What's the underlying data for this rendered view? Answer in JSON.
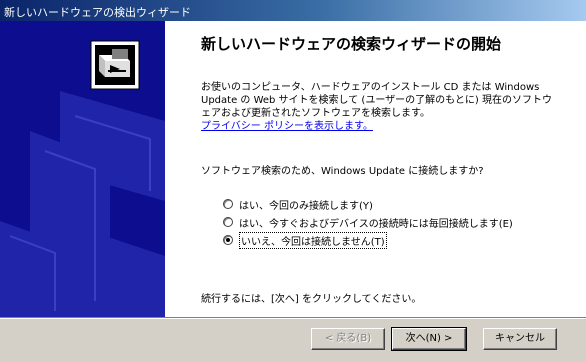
{
  "window": {
    "title": "新しいハードウェアの検出ウィザード"
  },
  "page": {
    "heading": "新しいハードウェアの検索ウィザードの開始",
    "intro_lines": [
      "お使いのコンピュータ、ハードウェアのインストール CD または Windows",
      "Update の Web サイトを検索して (ユーザーの了解のもとに) 現在のソフトウ",
      "ェアおよび更新されたソフトウェアを検索します。"
    ],
    "privacy_link": "プライバシー ポリシーを表示します。",
    "question": "ソフトウェア検索のため、Windows Update に接続しますか?",
    "options": [
      {
        "label": "はい、今回のみ接続します(Y)",
        "checked": false
      },
      {
        "label": "はい、今すぐおよびデバイスの接続時には毎回接続します(E)",
        "checked": false
      },
      {
        "label": "いいえ、今回は接続しません(T)",
        "checked": true
      }
    ],
    "continue_text": "続行するには、[次へ] をクリックしてください。"
  },
  "buttons": {
    "back": "< 戻る(B)",
    "next": "次へ(N) >",
    "cancel": "キャンセル"
  },
  "colors": {
    "banner": "#0d0e8f",
    "title_start": "#0a246a",
    "title_end": "#a6caf0",
    "link": "#0000ee"
  }
}
